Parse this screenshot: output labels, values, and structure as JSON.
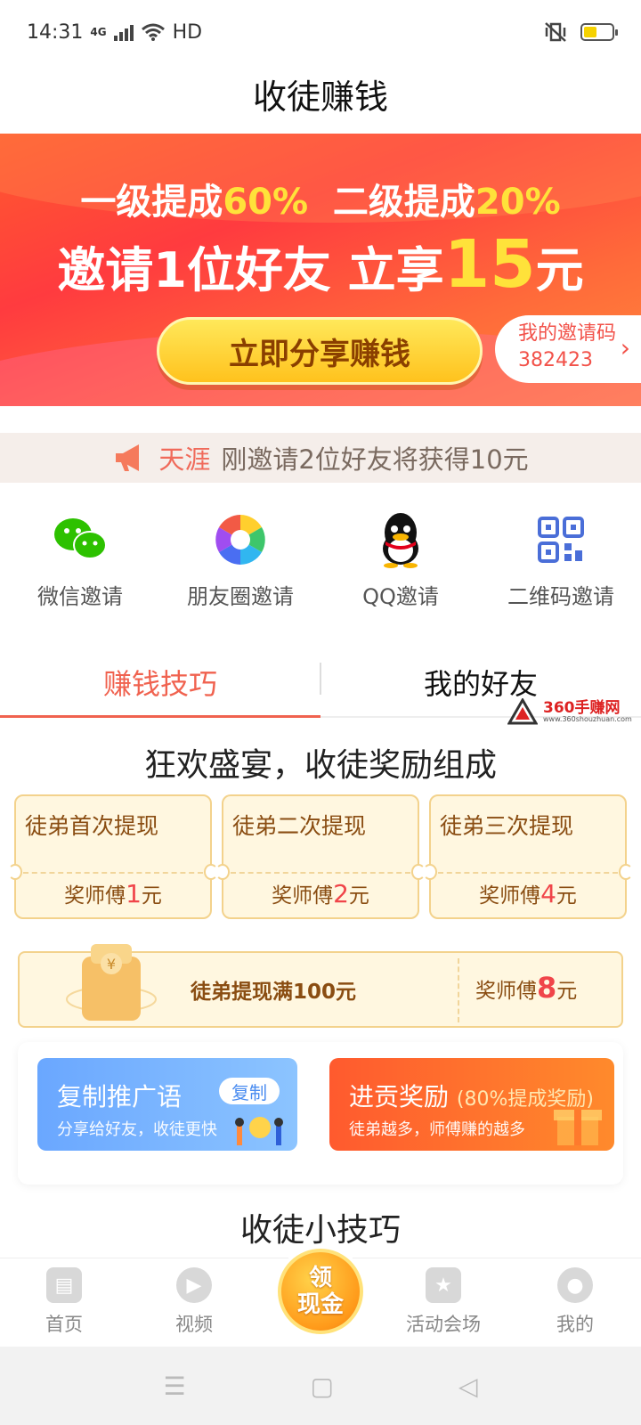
{
  "status_bar": {
    "time": "14:31",
    "network": "4G",
    "hd": "HD"
  },
  "header": {
    "title": "收徒赚钱"
  },
  "banner": {
    "line1_a": "一级提成",
    "line1_a_value": "60%",
    "line1_b": "二级提成",
    "line1_b_value": "20%",
    "line2_a": "邀请1位好友 立享",
    "line2_value": "15",
    "line2_unit": "元",
    "share_button": "立即分享赚钱",
    "invite_code_label": "我的邀请码",
    "invite_code": "382423"
  },
  "ticker": {
    "name": "天涯",
    "text": "刚邀请2位好友将获得10元"
  },
  "share_options": [
    {
      "label": "微信邀请",
      "icon": "wechat-icon"
    },
    {
      "label": "朋友圈邀请",
      "icon": "moments-icon"
    },
    {
      "label": "QQ邀请",
      "icon": "qq-icon"
    },
    {
      "label": "二维码邀请",
      "icon": "qrcode-icon"
    }
  ],
  "tabs": [
    {
      "label": "赚钱技巧",
      "active": true
    },
    {
      "label": "我的好友",
      "active": false
    }
  ],
  "watermark": {
    "text": "360手赚网",
    "url": "www.360shouzhuan.com"
  },
  "section": {
    "title": "狂欢盛宴，收徒奖励组成"
  },
  "tickets": [
    {
      "title": "徒弟首次提现",
      "reward_prefix": "奖师傅",
      "reward_value": "1",
      "reward_unit": "元"
    },
    {
      "title": "徒弟二次提现",
      "reward_prefix": "奖师傅",
      "reward_value": "2",
      "reward_unit": "元"
    },
    {
      "title": "徒弟三次提现",
      "reward_prefix": "奖师傅",
      "reward_value": "4",
      "reward_unit": "元"
    }
  ],
  "big_ticket": {
    "text": "徒弟提现满100元",
    "reward_prefix": "奖师傅",
    "reward_value": "8",
    "reward_unit": "元"
  },
  "promo": {
    "copy_title": "复制推广语",
    "copy_sub": "分享给好友，收徒更快",
    "copy_button": "复制",
    "tribute_title": "进贡奖励",
    "tribute_extra": "(80%提成奖励)",
    "tribute_sub": "徒弟越多，师傅赚的越多"
  },
  "tips": {
    "title": "收徒小技巧"
  },
  "bottom_nav": {
    "home": "首页",
    "video": "视频",
    "cash_line1": "领",
    "cash_line2": "现金",
    "events": "活动会场",
    "me": "我的"
  },
  "colors": {
    "accent": "#f0624f",
    "banner": "#ff3b3f",
    "gold": "#ffe23a"
  }
}
